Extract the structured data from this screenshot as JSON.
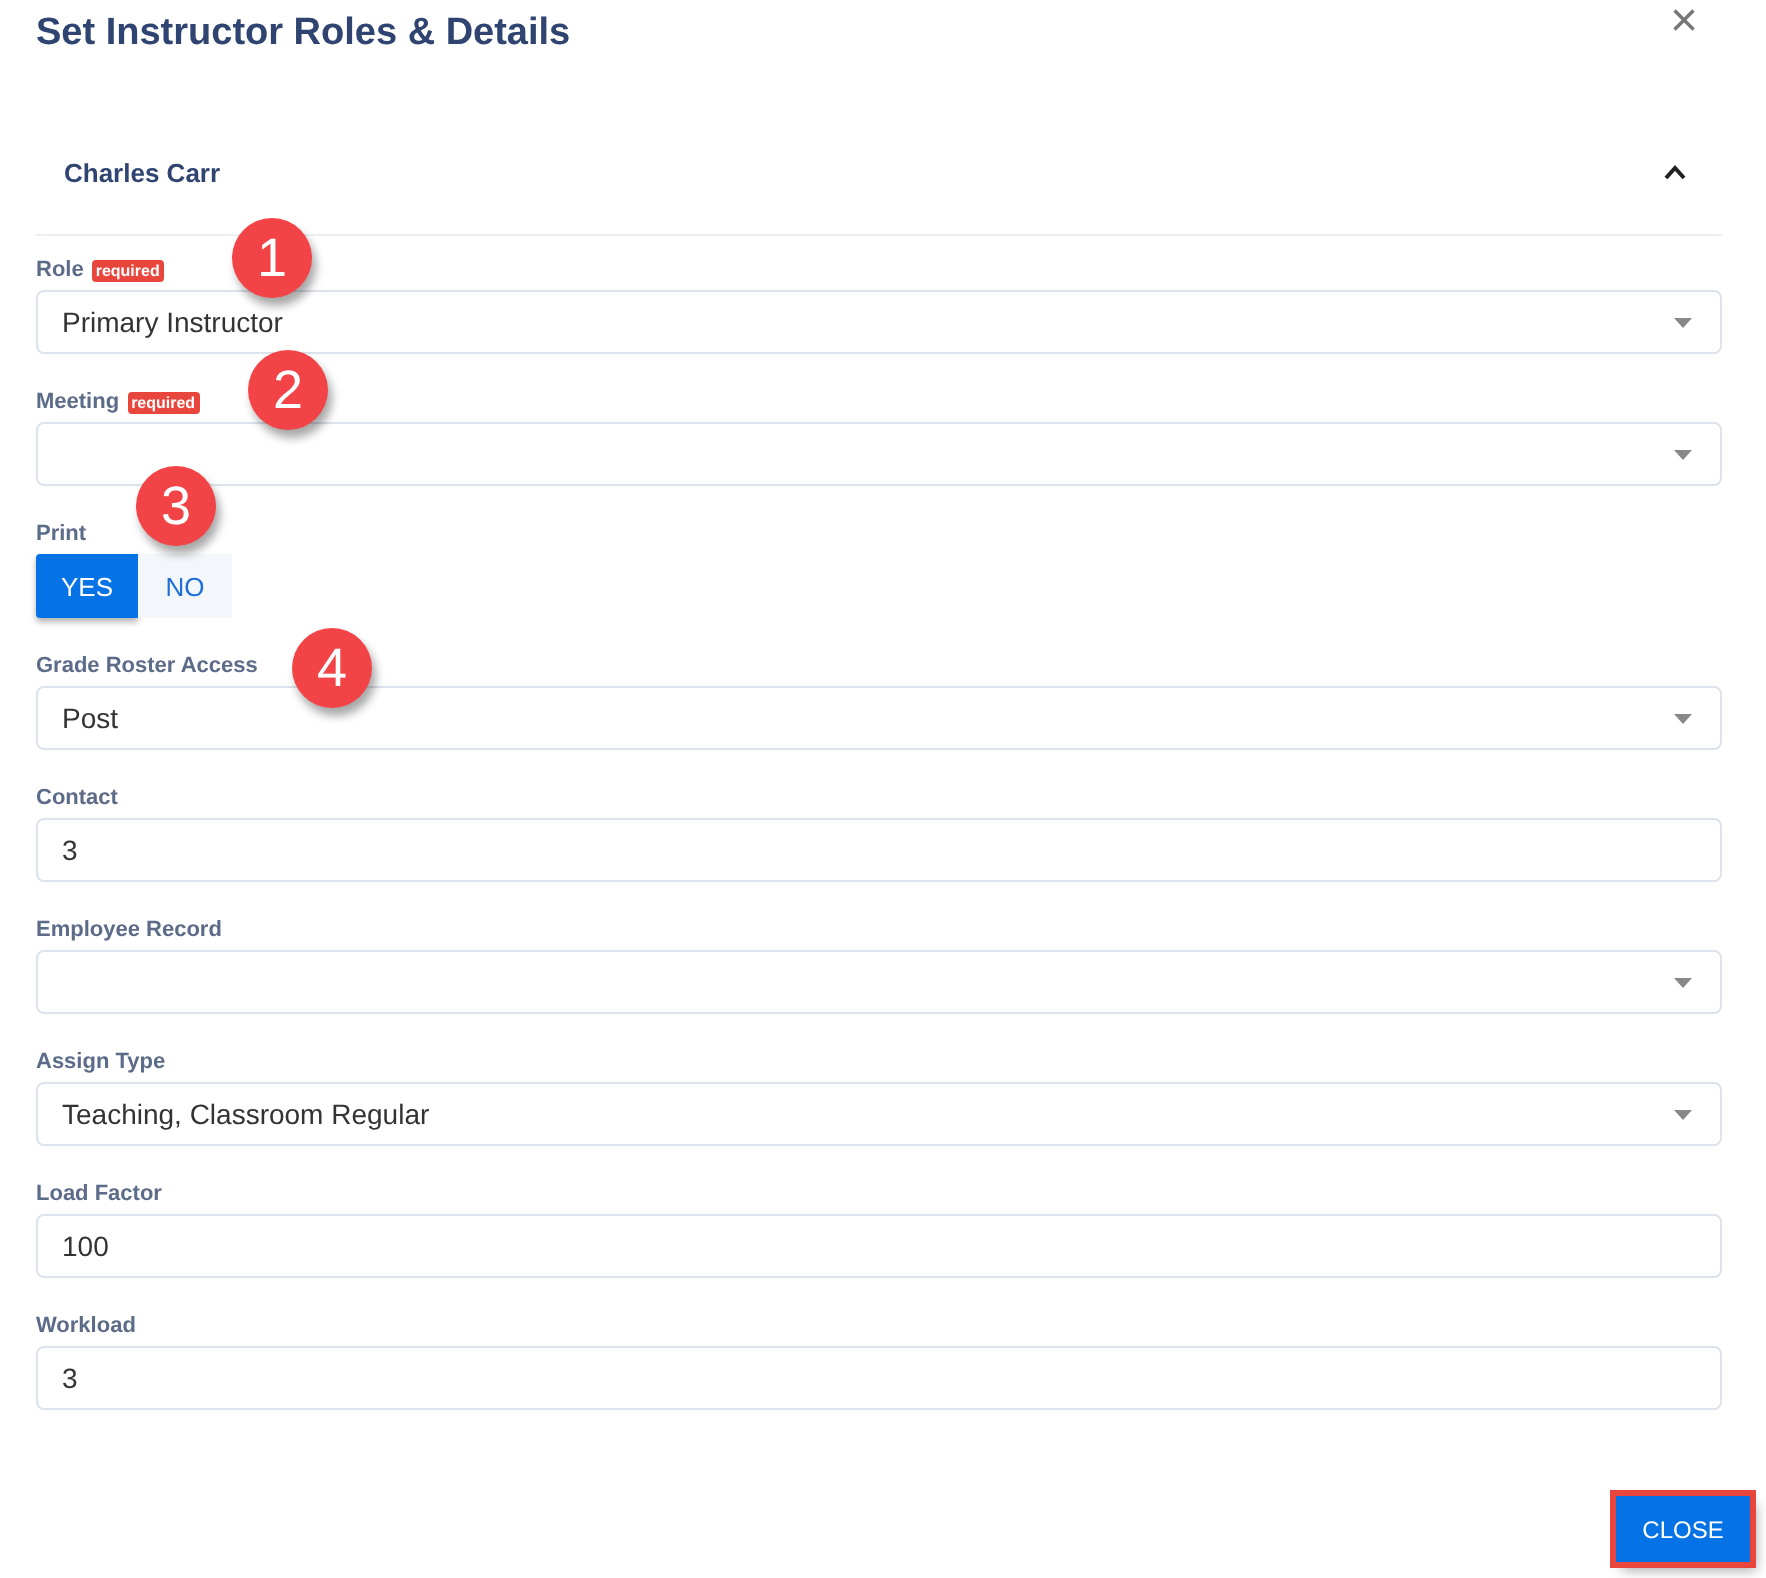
{
  "dialog": {
    "title": "Set Instructor Roles & Details",
    "close_icon": "×"
  },
  "section": {
    "title": "Charles Carr",
    "expanded": true
  },
  "fields": [
    {
      "kind": "select",
      "label": "Role",
      "required_badge": "required",
      "value": "Primary Instructor",
      "callout": "1"
    },
    {
      "kind": "select",
      "label": "Meeting",
      "required_badge": "required",
      "callout": "2"
    },
    {
      "kind": "toggle",
      "label": "Print",
      "options": [
        {
          "label": "YES",
          "selected": true
        },
        {
          "label": "NO",
          "selected": false
        }
      ],
      "callout": "3"
    },
    {
      "kind": "select",
      "label": "Grade Roster Access",
      "value": "Post",
      "callout": "4"
    },
    {
      "kind": "text",
      "label": "Contact",
      "value": "3"
    },
    {
      "kind": "select",
      "label": "Employee Record"
    },
    {
      "kind": "select",
      "label": "Assign Type",
      "value": "Teaching, Classroom Regular"
    },
    {
      "kind": "text",
      "label": "Load Factor",
      "value": "100"
    },
    {
      "kind": "text",
      "label": "Workload",
      "value": "3"
    }
  ],
  "footer": {
    "button": "CLOSE",
    "highlighted": true
  }
}
